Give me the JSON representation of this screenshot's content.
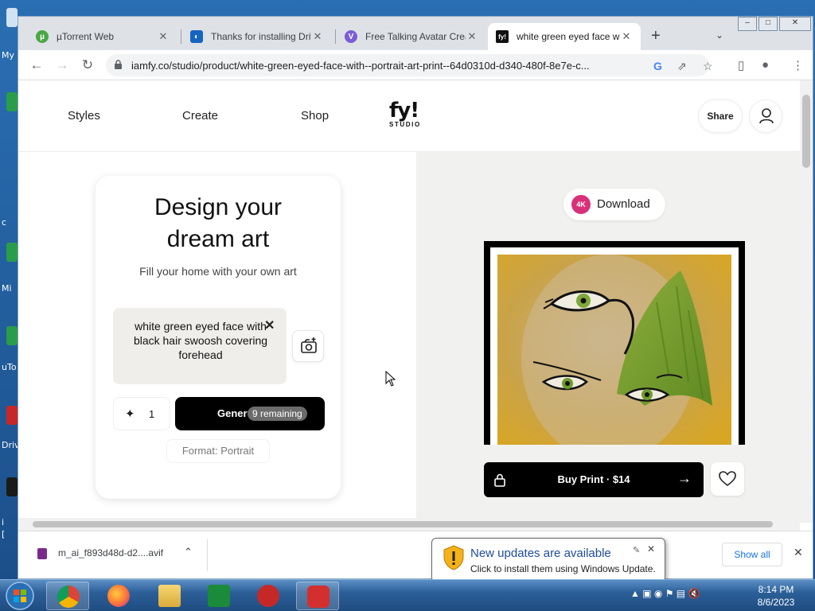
{
  "desktop": {
    "labels": [
      "My",
      "c",
      "Mi",
      "uTo",
      "Driv",
      "i",
      "["
    ]
  },
  "browser": {
    "tabs": [
      {
        "title": "µTorrent Web",
        "active": false
      },
      {
        "title": "Thanks for installing Driv",
        "active": false
      },
      {
        "title": "Free Talking Avatar Creat",
        "active": false
      },
      {
        "title": "white green eyed face w",
        "active": true
      }
    ],
    "url": "iamfy.co/studio/product/white-green-eyed-face-with--portrait-art-print--64d0310d-d340-480f-8e7e-c..."
  },
  "site": {
    "nav": [
      "Styles",
      "Create",
      "Shop"
    ],
    "logo": {
      "top": "fy!",
      "bottom": "STUDIO"
    },
    "share_label": "Share",
    "design_card": {
      "title_line1": "Design your",
      "title_line2": "dream art",
      "subtitle": "Fill your home with your own art",
      "prompt": "white green eyed face with black hair swoosh covering forehead",
      "count": "1",
      "generate_label": "Gener",
      "remaining": "9 remaining",
      "format": "Format: Portrait"
    },
    "preview": {
      "download_badge": "4K",
      "download_label": "Download",
      "buy_label": "Buy Print · $14"
    }
  },
  "downloads": {
    "filename": "m_ai_f893d48d-d2....avif",
    "show_all": "Show all"
  },
  "notification": {
    "title": "New updates are available",
    "message": "Click to install them using Windows Update."
  },
  "clock": {
    "time": "8:14 PM",
    "date": "8/6/2023"
  },
  "colors": {
    "accent_download": "#d9307a",
    "link": "#1a73e8",
    "notify_title": "#1e4c9a"
  }
}
